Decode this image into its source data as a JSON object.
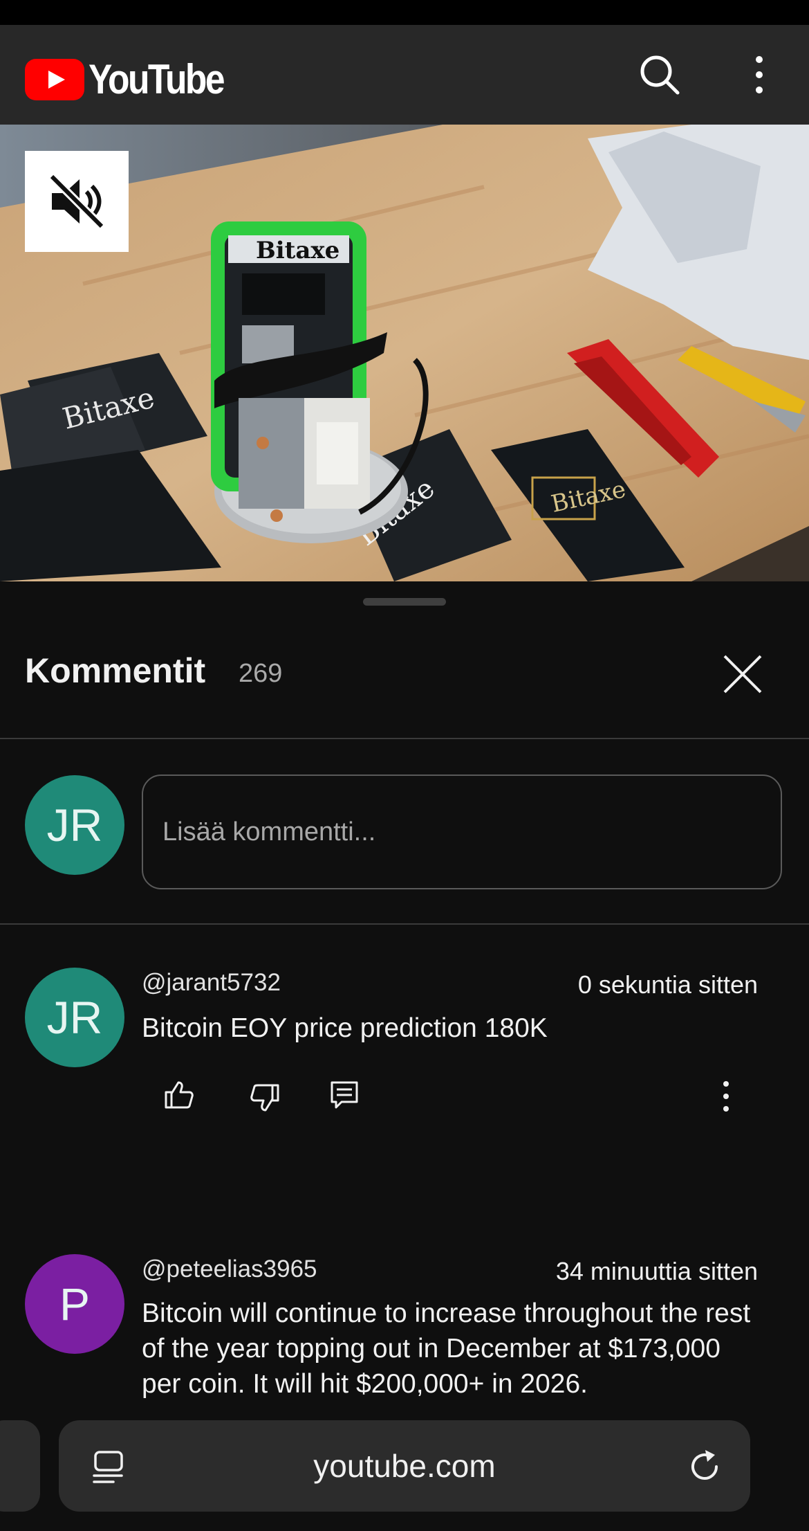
{
  "header": {
    "logo_text": "YouTube",
    "search_icon": "search-icon",
    "more_icon": "more-vert-icon"
  },
  "video": {
    "mute_icon": "volume-off-icon",
    "scene_labels": [
      "Bitaxe",
      "Bitaxe",
      "Bitaxe",
      "Bitaxe"
    ]
  },
  "comments_panel": {
    "title": "Kommentit",
    "count": "269",
    "close_icon": "close-icon",
    "input": {
      "avatar_initials": "JR",
      "placeholder": "Lisää kommentti..."
    },
    "comments": [
      {
        "avatar_initials": "JR",
        "avatar_color": "#1f8a78",
        "author": "@jarant5732",
        "time": "0 sekuntia sitten",
        "text": "Bitcoin EOY price prediction 180K",
        "actions": [
          "like-icon",
          "dislike-icon",
          "reply-icon",
          "more-vert-icon"
        ]
      },
      {
        "avatar_initials": "P",
        "avatar_color": "#7b1fa2",
        "author": "@peteelias3965",
        "time": "34 minuuttia sitten",
        "text": "Bitcoin will continue to increase throughout the rest of the year topping out in December at $173,000 per coin. It will hit $200,000+ in 2026."
      }
    ]
  },
  "browser": {
    "url": "youtube.com",
    "tabs_icon": "tabs-icon",
    "reload_icon": "reload-icon"
  },
  "colors": {
    "background": "#0f0f0f",
    "topbar": "#282828",
    "brand_red": "#ff0000",
    "avatar_jr": "#1f8a78",
    "avatar_p": "#7b1fa2"
  }
}
